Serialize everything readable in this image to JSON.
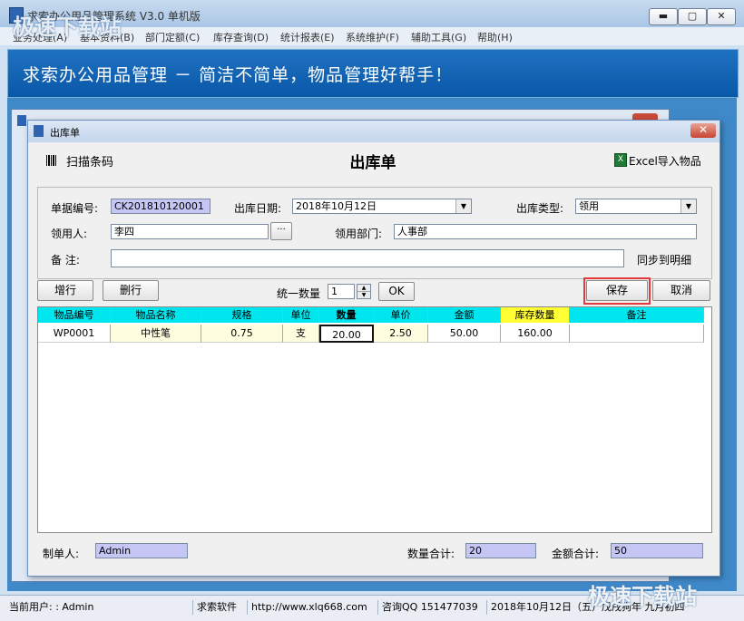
{
  "main_window": {
    "title": "求索办公用品管理系统 V3.0 单机版",
    "controls": {
      "minimize": "▬",
      "maximize": "▢",
      "close": "✕"
    }
  },
  "menu": [
    "业务处理(A)",
    "基本资料(B)",
    "部门定额(C)",
    "库存查询(D)",
    "统计报表(E)",
    "系统维护(F)",
    "辅助工具(G)",
    "帮助(H)"
  ],
  "banner": {
    "text": "求索办公用品管理 － 简洁不简单，物品管理好帮手！"
  },
  "watermark": "极速下载站",
  "dialog": {
    "title": "出库单",
    "close": "✕",
    "toolbar": {
      "scan_label": "扫描条码",
      "form_title": "出库单",
      "excel_label": "Excel导入物品",
      "excel_icon_text": "X"
    },
    "fields": {
      "doc_no_label": "单据编号:",
      "doc_no_value": "CK201810120001",
      "date_label": "出库日期:",
      "date_value": "2018年10月12日",
      "type_label": "出库类型:",
      "type_value": "领用",
      "receiver_label": "领用人:",
      "receiver_value": "李四",
      "dept_label": "领用部门:",
      "dept_value": "人事部",
      "remark_label": "备    注:",
      "remark_value": "",
      "sync_label": "同步到明细",
      "browse_button": "···",
      "dropdown_arrow": "▼"
    },
    "actions": {
      "add_row": "增行",
      "delete_row": "删行",
      "uniform_qty_label": "统一数量",
      "uniform_qty_value": "1",
      "spin_up": "▲",
      "spin_down": "▼",
      "ok": "OK",
      "save": "保存",
      "cancel": "取消"
    },
    "grid": {
      "columns": [
        "物品编号",
        "物品名称",
        "规格",
        "单位",
        "数量",
        "单价",
        "金额",
        "库存数量",
        "备注"
      ],
      "rows": [
        [
          "WP0001",
          "中性笔",
          "0.75",
          "支",
          "20.00",
          "2.50",
          "50.00",
          "160.00",
          ""
        ]
      ]
    },
    "footer": {
      "maker_label": "制单人:",
      "maker_value": "Admin",
      "qty_total_label": "数量合计:",
      "qty_total_value": "20",
      "amt_total_label": "金额合计:",
      "amt_total_value": "50"
    }
  },
  "statusbar": {
    "user": "当前用户: : Admin",
    "company": "求索软件",
    "url": "http://www.xlq668.com",
    "qq": "咨询QQ 151477039",
    "date": "2018年10月12日（五）戊戌狗年 九月初四"
  }
}
